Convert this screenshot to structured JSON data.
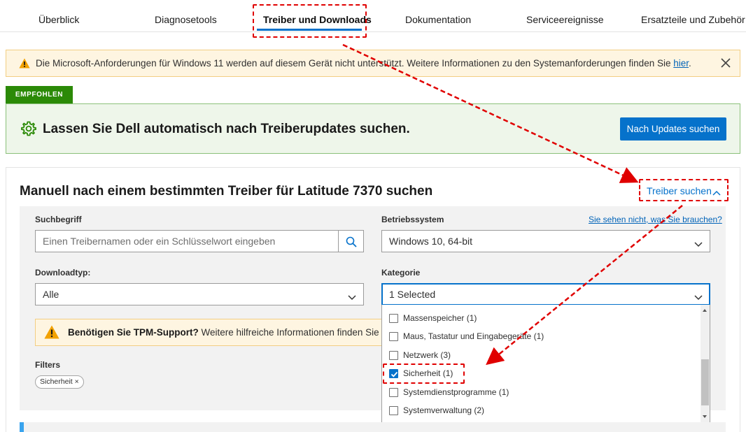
{
  "nav": {
    "tabs": [
      {
        "label": "Überblick"
      },
      {
        "label": "Diagnosetools"
      },
      {
        "label": "Treiber und Downloads"
      },
      {
        "label": "Dokumentation"
      },
      {
        "label": "Serviceereignisse"
      },
      {
        "label": "Ersatzteile und Zubehör"
      }
    ],
    "active_tab": "Treiber und Downloads"
  },
  "warning": {
    "text": "Die Microsoft-Anforderungen für Windows 11 werden auf diesem Gerät nicht unterstützt. Weitere Informationen zu den Systemanforderungen finden Sie ",
    "link": "hier",
    "end": ".",
    "close_icon": "close-icon"
  },
  "recommended": {
    "badge": "EMPFOHLEN",
    "title": "Lassen Sie Dell automatisch nach Treiberupdates suchen.",
    "button": "Nach Updates suchen",
    "icon": "gear-icon"
  },
  "manual": {
    "title": "Manuell nach einem bestimmten Treiber für Latitude 7370 suchen",
    "toggle": "Treiber suchen",
    "search": {
      "label": "Suchbegriff",
      "placeholder": "Einen Treibernamen oder ein Schlüsselwort eingeben"
    },
    "os": {
      "label": "Betriebssystem",
      "help": "Sie sehen nicht, was Sie brauchen?",
      "value": "Windows 10, 64-bit"
    },
    "download_type": {
      "label": "Downloadtyp:",
      "value": "Alle"
    },
    "category": {
      "label": "Kategorie",
      "value": "1 Selected",
      "options": [
        {
          "label": "Massenspeicher (1)",
          "checked": false
        },
        {
          "label": "Maus, Tastatur und Eingabegeräte (1)",
          "checked": false
        },
        {
          "label": "Netzwerk (3)",
          "checked": false
        },
        {
          "label": "Sicherheit (1)",
          "checked": true
        },
        {
          "label": "Systemdienstprogramme (1)",
          "checked": false
        },
        {
          "label": "Systemverwaltung (2)",
          "checked": false
        }
      ]
    },
    "tpm": {
      "bold": "Benötigen Sie TPM-Support?",
      "text": " Weitere hilfreiche Informationen finden Sie in unserem"
    },
    "filters": {
      "label": "Filters",
      "chip": "Sicherheit"
    }
  },
  "colors": {
    "accent": "#0672cb",
    "success": "#2b8a07",
    "warning_bg": "#fef5e1",
    "callout": "#e00000"
  }
}
